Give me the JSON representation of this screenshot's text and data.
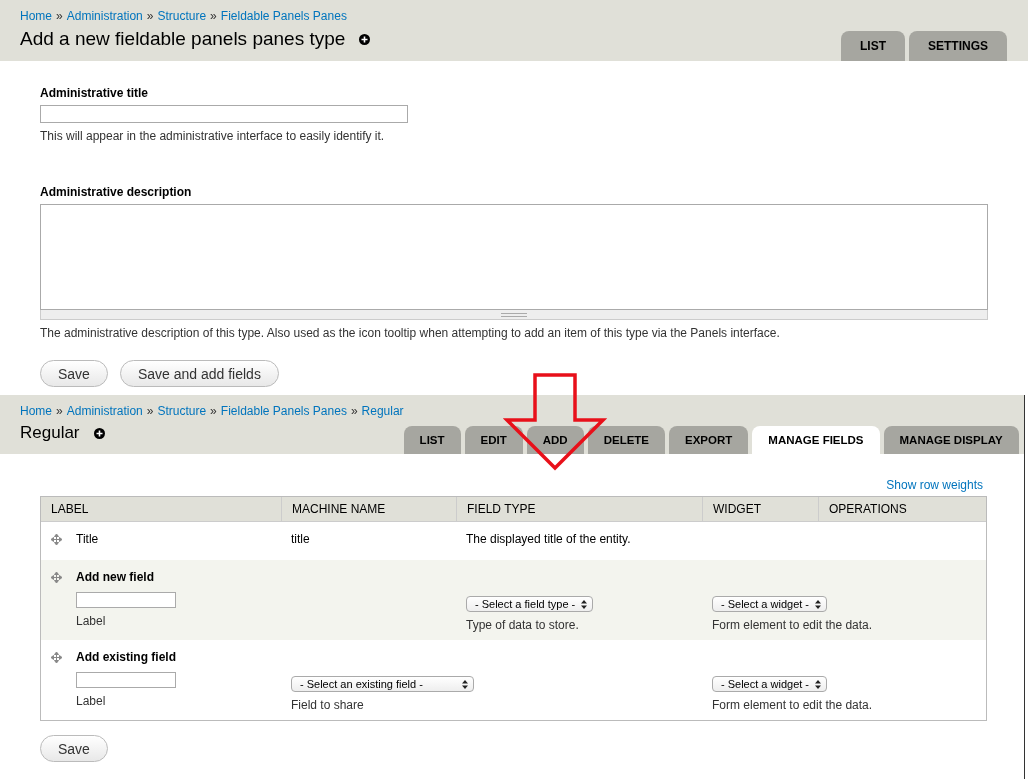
{
  "form_page": {
    "breadcrumb": [
      "Home",
      "Administration",
      "Structure",
      "Fieldable Panels Panes"
    ],
    "separator": "»",
    "title": "Add a new fieldable panels panes type",
    "tabs": [
      {
        "label": "LIST",
        "selected": false
      },
      {
        "label": "SETTINGS",
        "selected": false
      }
    ],
    "fields": [
      {
        "kind": "input",
        "label": "Administrative title",
        "description": "This will appear in the administrative interface to easily identify it."
      },
      {
        "kind": "textarea",
        "label": "Administrative description",
        "description": "The administrative description of this type. Also used as the icon tooltip when attempting to add an item of this type via the Panels interface."
      }
    ],
    "buttons": [
      "Save",
      "Save and add fields"
    ]
  },
  "fields_page": {
    "breadcrumb": [
      "Home",
      "Administration",
      "Structure",
      "Fieldable Panels Panes",
      "Regular"
    ],
    "separator": "»",
    "title": "Regular",
    "tabs": [
      {
        "label": "LIST",
        "selected": false
      },
      {
        "label": "EDIT",
        "selected": false
      },
      {
        "label": "ADD",
        "selected": false
      },
      {
        "label": "DELETE",
        "selected": false
      },
      {
        "label": "EXPORT",
        "selected": false
      },
      {
        "label": "MANAGE FIELDS",
        "selected": true
      },
      {
        "label": "MANAGE DISPLAY",
        "selected": false
      }
    ],
    "row_weights_link": "Show row weights",
    "table": {
      "columns": [
        "LABEL",
        "MACHINE NAME",
        "FIELD TYPE",
        "WIDGET",
        "OPERATIONS"
      ],
      "rows": [
        {
          "kind": "field",
          "cells": [
            "Title",
            "title",
            "The displayed title of the entity.",
            "",
            ""
          ]
        },
        {
          "kind": "add",
          "label_field": {
            "description": "Label"
          },
          "cells": [
            "Add new field",
            "",
            {
              "value": "- Select a field type -",
              "description": "Type of data to store."
            },
            {
              "value": "- Select a widget -",
              "description": "Form element to edit the data."
            },
            ""
          ]
        },
        {
          "kind": "add",
          "label_field": {
            "description": "Label"
          },
          "cells": [
            "Add existing field",
            {
              "value": "- Select an existing field -",
              "description": "Field to share"
            },
            "",
            {
              "value": "- Select a widget -",
              "description": "Form element to edit the data."
            },
            ""
          ]
        }
      ]
    },
    "buttons": [
      "Save"
    ]
  }
}
